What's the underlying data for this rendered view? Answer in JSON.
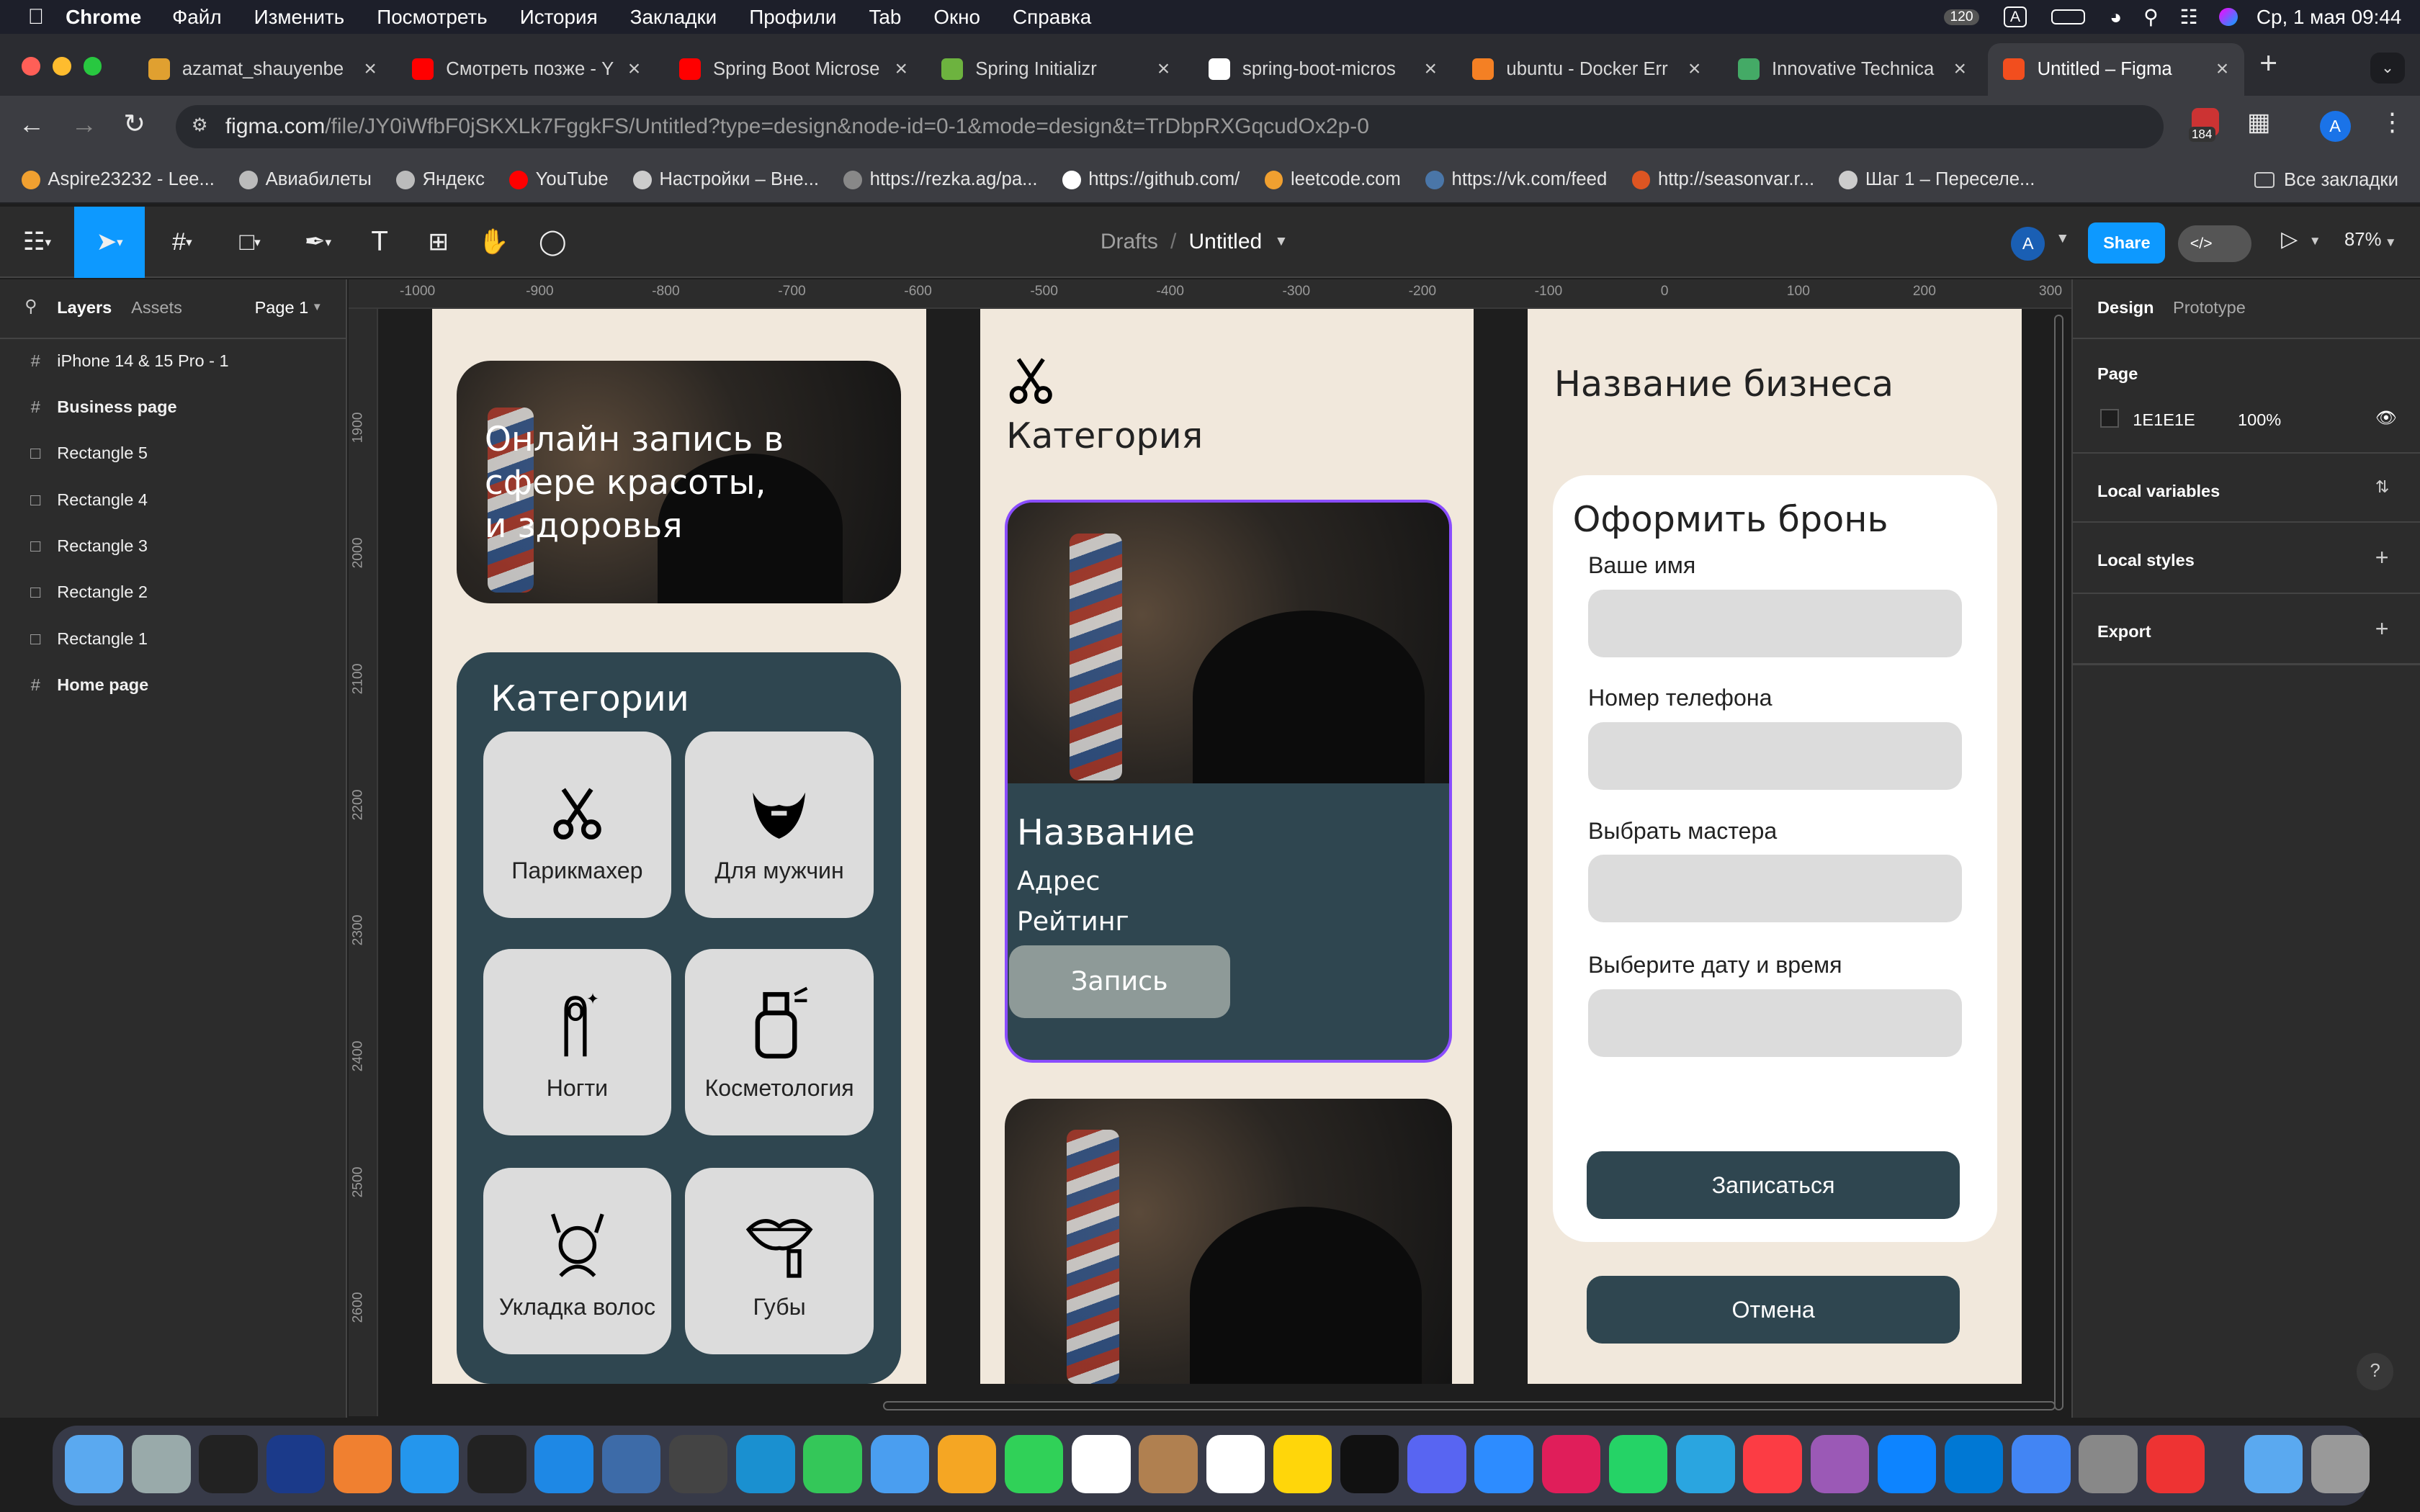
{
  "menubar": {
    "app": "Chrome",
    "items": [
      "Файл",
      "Изменить",
      "Посмотреть",
      "История",
      "Закладки",
      "Профили",
      "Tab",
      "Окно",
      "Справка"
    ],
    "badge": "120",
    "input_lang": "A",
    "datetime": "Ср, 1 мая  09:44"
  },
  "tabs": [
    {
      "title": "azamat_shauyenbe",
      "color": "#e0a030"
    },
    {
      "title": "Смотреть позже - Y",
      "color": "#ff0000"
    },
    {
      "title": "Spring Boot Microse",
      "color": "#ff0000"
    },
    {
      "title": "Spring Initializr",
      "color": "#6db33f"
    },
    {
      "title": "spring-boot-micros",
      "color": "#ffffff"
    },
    {
      "title": "ubuntu - Docker Err",
      "color": "#f48024"
    },
    {
      "title": "Innovative Technica",
      "color": "#44aa66"
    },
    {
      "title": "Untitled – Figma",
      "color": "#f24e1e"
    }
  ],
  "address": {
    "host": "figma.com",
    "path": "/file/JY0iWfbF0jSKXLk7FggkFS/Untitled?type=design&node-id=0-1&mode=design&t=TrDbpRXGqcudOx2p-0",
    "ext_badge": "184",
    "avatar": "A"
  },
  "bookmarks": [
    {
      "label": "Aspire23232 - Lee...",
      "color": "#f0a030"
    },
    {
      "label": "Авиабилеты",
      "color": "#bbbbbb"
    },
    {
      "label": "Яндекс",
      "color": "#bbbbbb"
    },
    {
      "label": "YouTube",
      "color": "#ff0000"
    },
    {
      "label": "Настройки – Вне...",
      "color": "#cccccc"
    },
    {
      "label": "https://rezka.ag/pa...",
      "color": "#888888"
    },
    {
      "label": "https://github.com/",
      "color": "#ffffff"
    },
    {
      "label": "leetcode.com",
      "color": "#f0a030"
    },
    {
      "label": "https://vk.com/feed",
      "color": "#4a76a8"
    },
    {
      "label": "http://seasonvar.r...",
      "color": "#dd5522"
    },
    {
      "label": "Шаг 1 – Переселе...",
      "color": "#cccccc"
    }
  ],
  "all_bookmarks": "Все закладки",
  "figma": {
    "breadcrumb_root": "Drafts",
    "file_name": "Untitled",
    "share": "Share",
    "zoom": "87%",
    "avatar": "A"
  },
  "left_panel": {
    "tabs": [
      "Layers",
      "Assets"
    ],
    "page": "Page 1",
    "layers": [
      {
        "name": "iPhone 14 & 15 Pro - 1",
        "type": "frame",
        "bold": false
      },
      {
        "name": "Business page",
        "type": "frame",
        "bold": true
      },
      {
        "name": "Rectangle 5",
        "type": "rect",
        "bold": false
      },
      {
        "name": "Rectangle 4",
        "type": "rect",
        "bold": false
      },
      {
        "name": "Rectangle 3",
        "type": "rect",
        "bold": false
      },
      {
        "name": "Rectangle 2",
        "type": "rect",
        "bold": false
      },
      {
        "name": "Rectangle 1",
        "type": "rect",
        "bold": false
      },
      {
        "name": "Home page",
        "type": "frame",
        "bold": true
      }
    ]
  },
  "right_panel": {
    "tabs": [
      "Design",
      "Prototype"
    ],
    "page_label": "Page",
    "page_color": "1E1E1E",
    "page_opacity": "100%",
    "sections": [
      "Local variables",
      "Local styles",
      "Export"
    ]
  },
  "rulers": {
    "top": [
      "-1000",
      "-900",
      "-800",
      "-700",
      "-600",
      "-500",
      "-400",
      "-300",
      "-200",
      "-100",
      "0",
      "100",
      "200",
      "300"
    ],
    "left": [
      "1900",
      "2000",
      "2100",
      "2200",
      "2300",
      "2400",
      "2500",
      "2600"
    ]
  },
  "frame1": {
    "hero_text": "Онлайн запись в сфере красоты, и здоровья",
    "categories_title": "Категории",
    "categories": [
      {
        "label": "Парикмахер",
        "icon": "scissors-icon"
      },
      {
        "label": "Для мужчин",
        "icon": "beard-icon"
      },
      {
        "label": "Ногти",
        "icon": "nail-icon"
      },
      {
        "label": "Косметология",
        "icon": "spray-bottle-icon"
      },
      {
        "label": "Укладка волос",
        "icon": "hair-styling-icon"
      },
      {
        "label": "Губы",
        "icon": "lips-icon"
      }
    ]
  },
  "frame2": {
    "title": "Категория",
    "card_name": "Название",
    "card_address": "Адрес",
    "card_rating": "Рейтинг",
    "book_button": "Запись"
  },
  "frame3": {
    "title": "Название бизнеса",
    "form_title": "Оформить бронь",
    "fields": [
      "Ваше имя",
      "Номер телефона",
      "Выбрать мастера",
      "Выберите дату и время"
    ],
    "submit": "Записаться",
    "cancel": "Отмена"
  },
  "colors": {
    "frame_bg": "#f1e8dc",
    "accent_dark": "#2f4650",
    "figma_blue": "#0d99ff",
    "selection": "#8a4dff"
  }
}
